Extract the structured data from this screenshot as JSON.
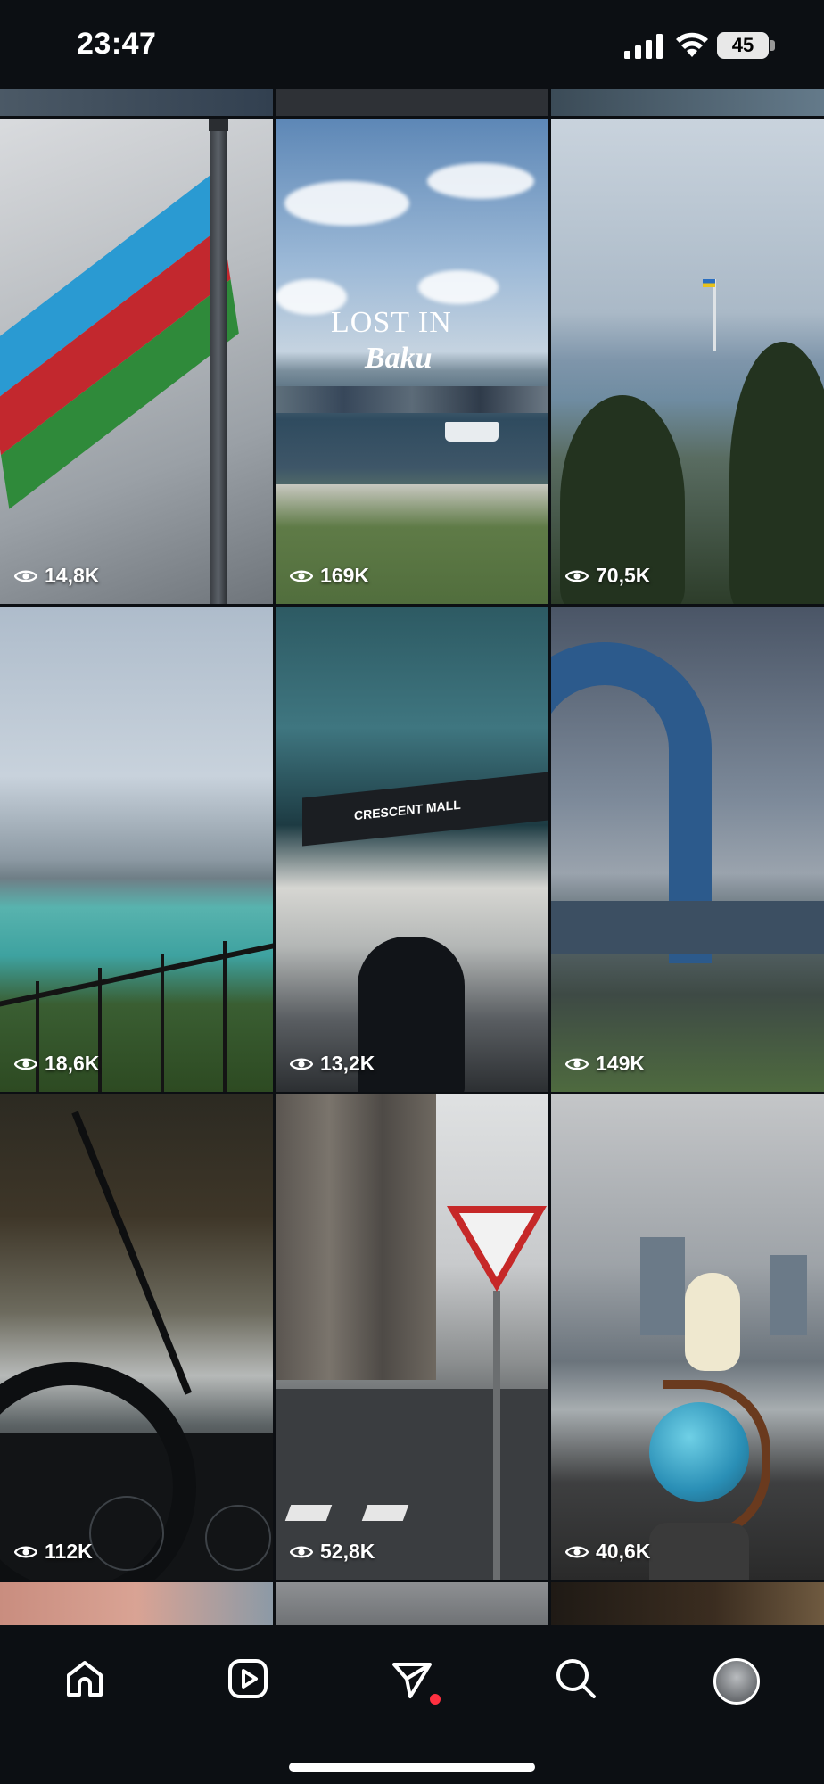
{
  "status_bar": {
    "time": "23:47",
    "battery": "45"
  },
  "grid": {
    "top_row_partial": [
      "",
      "",
      ""
    ],
    "tiles": [
      {
        "views": "14,8K"
      },
      {
        "views": "169K",
        "overlay_line1": "LOST IN",
        "overlay_line2": "Baku"
      },
      {
        "views": "70,5K"
      },
      {
        "views": "18,6K"
      },
      {
        "views": "13,2K",
        "sign_text": "CRESCENT MALL"
      },
      {
        "views": "149K"
      },
      {
        "views": "112K"
      },
      {
        "views": "52,8K"
      },
      {
        "views": "40,6K"
      }
    ]
  },
  "bottom_nav": {
    "items": [
      "home-icon",
      "reels-icon",
      "direct-messages-icon",
      "search-icon",
      "profile-avatar"
    ],
    "notification_color": "#ff3040"
  }
}
